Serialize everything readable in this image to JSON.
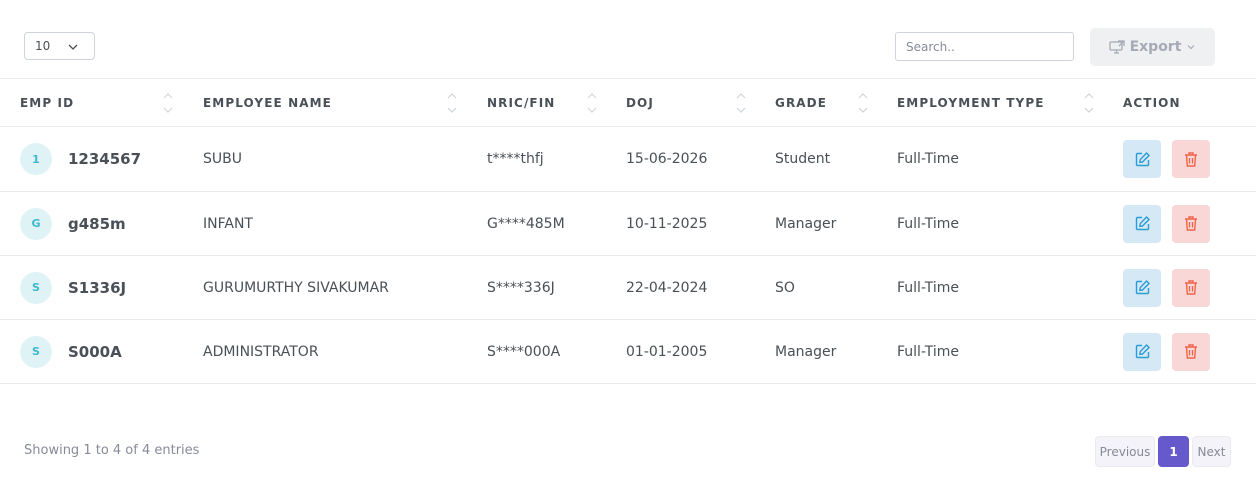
{
  "toolbar": {
    "page_size": "10",
    "search_placeholder": "Search..",
    "export_label": "Export"
  },
  "table": {
    "headers": [
      "EMP ID",
      "EMPLOYEE NAME",
      "NRIC/FIN",
      "DOJ",
      "GRADE",
      "EMPLOYMENT TYPE",
      "ACTION"
    ],
    "rows": [
      {
        "initial": "1",
        "emp_id": "1234567",
        "name": "SUBU",
        "nric": "t****thfj",
        "doj": "15-06-2026",
        "grade": "Student",
        "type": "Full-Time"
      },
      {
        "initial": "G",
        "emp_id": "g485m",
        "name": "INFANT",
        "nric": "G****485M",
        "doj": "10-11-2025",
        "grade": "Manager",
        "type": "Full-Time"
      },
      {
        "initial": "S",
        "emp_id": "S1336J",
        "name": "GURUMURTHY SIVAKUMAR",
        "nric": "S****336J",
        "doj": "22-04-2024",
        "grade": "SO",
        "type": "Full-Time"
      },
      {
        "initial": "S",
        "emp_id": "S000A",
        "name": "ADMINISTRATOR",
        "nric": "S****000A",
        "doj": "01-01-2005",
        "grade": "Manager",
        "type": "Full-Time"
      }
    ]
  },
  "footer": {
    "info": "Showing 1 to 4 of 4 entries",
    "prev": "Previous",
    "page": "1",
    "next": "Next"
  },
  "icons": {
    "chevron": "chevron-down-icon",
    "export": "export-icon",
    "sort": "sort-icon",
    "edit": "edit-icon",
    "delete": "trash-icon"
  },
  "colors": {
    "accent": "#6559cc",
    "edit_bg": "#d4e8f5",
    "edit_icon": "#299cdb",
    "delete_bg": "#f9d7d7",
    "delete_icon": "#f06548",
    "avatar_bg": "#dff3f7"
  }
}
